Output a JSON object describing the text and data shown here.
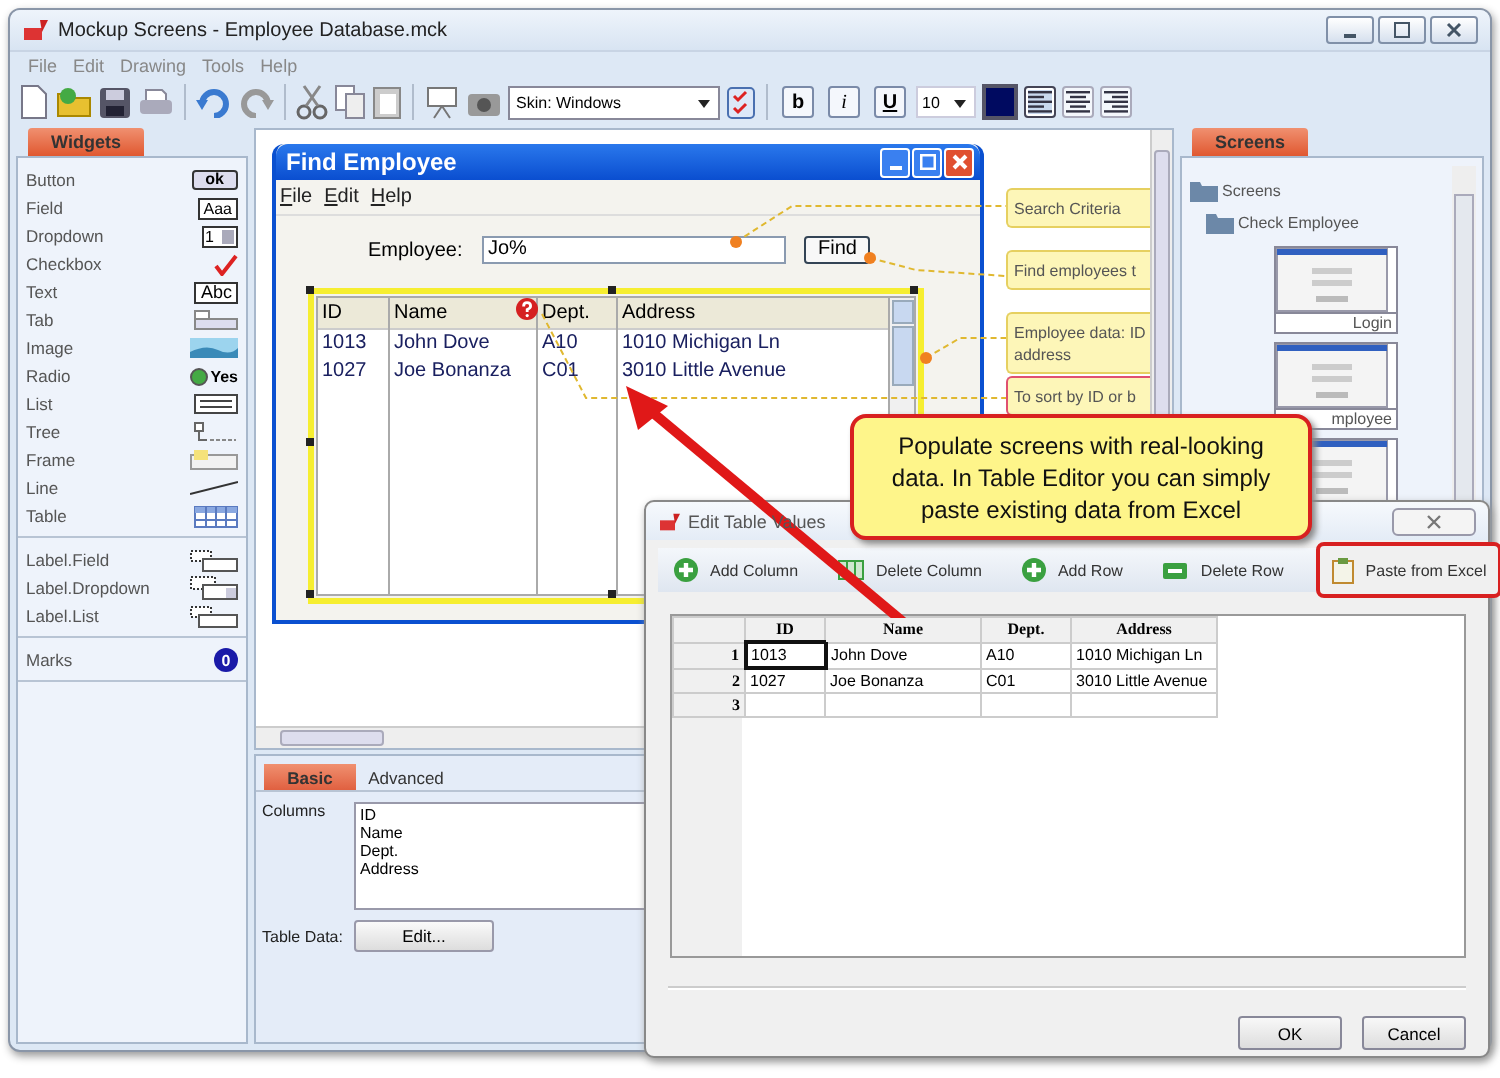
{
  "window": {
    "title": "Mockup Screens - Employee Database.mck"
  },
  "menu": [
    "File",
    "Edit",
    "Drawing",
    "Tools",
    "Help"
  ],
  "toolbar": {
    "skin": "Skin: Windows",
    "font_size": "10",
    "bold": "b",
    "italic": "i",
    "underline": "U",
    "align_buttons": [
      {
        "kind": "left",
        "selected": true
      },
      {
        "kind": "center",
        "selected": false
      },
      {
        "kind": "right",
        "selected": false
      }
    ]
  },
  "widgets_panel": {
    "tab": "Widgets",
    "groups": [
      [
        {
          "label": "Button",
          "kind": "button",
          "sample": "ok"
        },
        {
          "label": "Field",
          "kind": "field",
          "sample": "Aaa"
        },
        {
          "label": "Dropdown",
          "kind": "dropdown",
          "sample": "1"
        },
        {
          "label": "Checkbox",
          "kind": "checkbox"
        },
        {
          "label": "Text",
          "kind": "text",
          "sample": "Abc"
        },
        {
          "label": "Tab",
          "kind": "tab"
        },
        {
          "label": "Image",
          "kind": "image"
        },
        {
          "label": "Radio",
          "kind": "radio",
          "sample": "Yes"
        },
        {
          "label": "List",
          "kind": "list"
        },
        {
          "label": "Tree",
          "kind": "tree"
        },
        {
          "label": "Frame",
          "kind": "frame"
        },
        {
          "label": "Line",
          "kind": "line"
        },
        {
          "label": "Table",
          "kind": "table"
        }
      ],
      [
        {
          "label": "Label.Field",
          "kind": "label-field"
        },
        {
          "label": "Label.Dropdown",
          "kind": "label-dropdown"
        },
        {
          "label": "Label.List",
          "kind": "label-list"
        }
      ],
      [
        {
          "label": "Marks",
          "kind": "marks",
          "sample": "0"
        }
      ]
    ]
  },
  "find_employee": {
    "title": "Find Employee",
    "menu": [
      "File",
      "Edit",
      "Help"
    ],
    "field_label": "Employee:",
    "field_value": "Jo%",
    "button": "Find",
    "columns": [
      "ID",
      "Name",
      "Dept.",
      "Address"
    ],
    "rows": [
      [
        "1013",
        "John Dove",
        "A10",
        "1010 Michigan Ln"
      ],
      [
        "1027",
        "Joe Bonanza",
        "C01",
        "3010 Little Avenue"
      ]
    ]
  },
  "notes": [
    {
      "lines": [
        "Search Criteria"
      ],
      "selected": false
    },
    {
      "lines": [
        "Find employees t"
      ],
      "selected": false
    },
    {
      "lines": [
        "Employee data: ID",
        "address"
      ],
      "selected": false
    },
    {
      "lines": [
        "To sort by ID or b"
      ],
      "selected": true
    }
  ],
  "screens_panel": {
    "tab": "Screens",
    "root": "Screens",
    "folder": "Check Employee",
    "thumbnails": [
      {
        "kind": "thumbnail",
        "label": "Login"
      },
      {
        "kind": "thumbnail",
        "label": "mployee"
      },
      {
        "kind": "thumbnail"
      }
    ]
  },
  "properties": {
    "tabs": [
      {
        "label": "Basic",
        "selected": true
      },
      {
        "label": "Advanced",
        "selected": false
      }
    ],
    "columns_label": "Columns",
    "columns": [
      "ID",
      "Name",
      "Dept.",
      "Address"
    ],
    "table_data_label": "Table Data:",
    "edit_button": "Edit..."
  },
  "callout": {
    "lines": [
      "Populate screens with real-looking",
      "data. In Table Editor you can simply",
      "paste existing data from Excel"
    ]
  },
  "table_editor": {
    "title": "Edit Table Values",
    "actions": [
      {
        "label": "Add Column",
        "kind": "add",
        "highlighted": false
      },
      {
        "label": "Delete Column",
        "kind": "remove-column",
        "highlighted": false
      },
      {
        "label": "Add Row",
        "kind": "add",
        "highlighted": false
      },
      {
        "label": "Delete Row",
        "kind": "remove",
        "highlighted": false
      },
      {
        "label": "Paste from Excel",
        "kind": "paste",
        "highlighted": true
      }
    ],
    "columns": [
      "ID",
      "Name",
      "Dept.",
      "Address"
    ],
    "rows": [
      {
        "number": "1",
        "cells": [
          {
            "text": "1013",
            "selected": true
          },
          {
            "text": "John Dove",
            "selected": false
          },
          {
            "text": "A10",
            "selected": false
          },
          {
            "text": "1010 Michigan Ln",
            "selected": false
          }
        ]
      },
      {
        "number": "2",
        "cells": [
          {
            "text": "1027",
            "selected": false
          },
          {
            "text": "Joe Bonanza",
            "selected": false
          },
          {
            "text": "C01",
            "selected": false
          },
          {
            "text": "3010 Little Avenue",
            "selected": false
          }
        ]
      },
      {
        "number": "3"
      }
    ],
    "buttons": [
      "OK",
      "Cancel"
    ]
  }
}
